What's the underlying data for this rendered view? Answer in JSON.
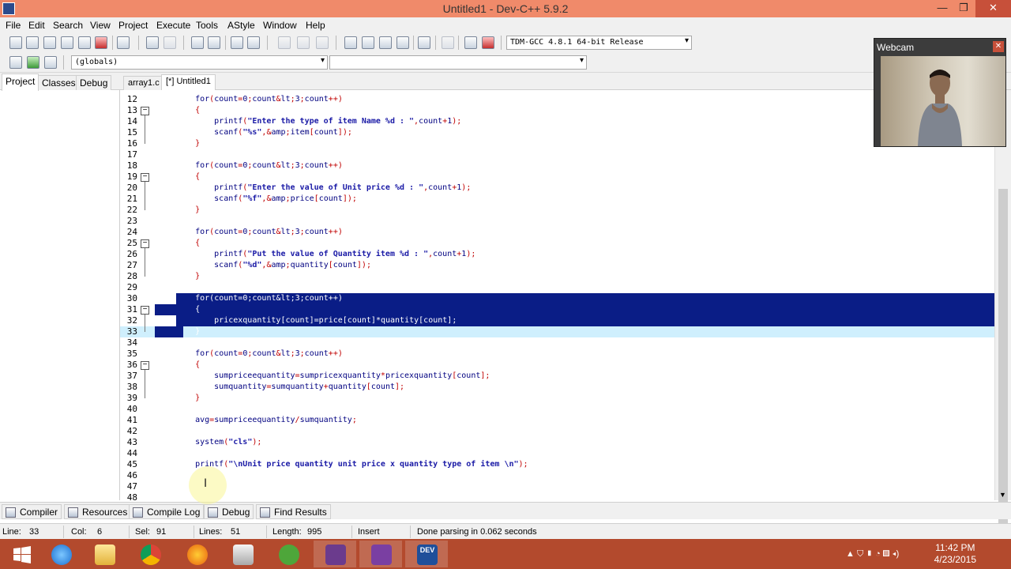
{
  "window": {
    "title": "Untitled1 - Dev-C++ 5.9.2",
    "minimize_glyph": "—",
    "maximize_glyph": "❐",
    "close_glyph": "✕"
  },
  "menu": [
    "File",
    "Edit",
    "Search",
    "View",
    "Project",
    "Execute",
    "Tools",
    "AStyle",
    "Window",
    "Help"
  ],
  "toolbar": {
    "compiler_select": "TDM-GCC 4.8.1 64-bit Release",
    "scope_select": "(globals)",
    "function_select": "",
    "dropdown_glyph": "▾"
  },
  "left_panel": {
    "tabs": [
      "Project",
      "Classes",
      "Debug"
    ],
    "active_tab": "Project"
  },
  "editor_tabs": [
    {
      "label": "array1.c",
      "active": false
    },
    {
      "label": "[*] Untitled1",
      "active": true
    }
  ],
  "editor": {
    "fold_glyph": "−",
    "lines": [
      {
        "num": "12",
        "text": "    for(count=0;count<3;count++)"
      },
      {
        "num": "13",
        "text": "    {"
      },
      {
        "num": "14",
        "text": "        printf(\"Enter the type of item Name %d : \",count+1);"
      },
      {
        "num": "15",
        "text": "        scanf(\"%s\",&item[count]);"
      },
      {
        "num": "16",
        "text": "    }"
      },
      {
        "num": "17",
        "text": ""
      },
      {
        "num": "18",
        "text": "    for(count=0;count<3;count++)"
      },
      {
        "num": "19",
        "text": "    {"
      },
      {
        "num": "20",
        "text": "        printf(\"Enter the value of Unit price %d : \",count+1);"
      },
      {
        "num": "21",
        "text": "        scanf(\"%f\",&price[count]);"
      },
      {
        "num": "22",
        "text": "    }"
      },
      {
        "num": "23",
        "text": ""
      },
      {
        "num": "24",
        "text": "    for(count=0;count<3;count++)"
      },
      {
        "num": "25",
        "text": "    {"
      },
      {
        "num": "26",
        "text": "        printf(\"Put the value of Quantity item %d : \",count+1);"
      },
      {
        "num": "27",
        "text": "        scanf(\"%d\",&quantity[count]);"
      },
      {
        "num": "28",
        "text": "    }"
      },
      {
        "num": "29",
        "text": ""
      },
      {
        "num": "30",
        "text": "    for(count=0;count<3;count++)"
      },
      {
        "num": "31",
        "text": "    {"
      },
      {
        "num": "32",
        "text": "        pricexquantity[count]=price[count]*quantity[count];"
      },
      {
        "num": "33",
        "text": "    }"
      },
      {
        "num": "34",
        "text": ""
      },
      {
        "num": "35",
        "text": "    for(count=0;count<3;count++)"
      },
      {
        "num": "36",
        "text": "    {"
      },
      {
        "num": "37",
        "text": "        sumpriceequantity=sumpricexquantity*pricexquantity[count];"
      },
      {
        "num": "38",
        "text": "        sumquantity=sumquantity+quantity[count];"
      },
      {
        "num": "39",
        "text": "    }"
      },
      {
        "num": "40",
        "text": ""
      },
      {
        "num": "41",
        "text": "    avg=sumpriceequantity/sumquantity;"
      },
      {
        "num": "42",
        "text": ""
      },
      {
        "num": "43",
        "text": "    system(\"cls\");"
      },
      {
        "num": "44",
        "text": ""
      },
      {
        "num": "45",
        "text": "    printf(\"\\nUnit price quantity unit price x quantity type of item \\n\");"
      },
      {
        "num": "46",
        "text": ""
      },
      {
        "num": "47",
        "text": ""
      },
      {
        "num": "48",
        "text": ""
      }
    ]
  },
  "webcam": {
    "title": "Webcam",
    "close_glyph": "✕"
  },
  "bottom_tabs": [
    "Compiler",
    "Resources",
    "Compile Log",
    "Debug",
    "Find Results"
  ],
  "status": {
    "line_label": "Line:",
    "line_value": "33",
    "col_label": "Col:",
    "col_value": "6",
    "sel_label": "Sel:",
    "sel_value": "91",
    "lines_label": "Lines:",
    "lines_value": "51",
    "length_label": "Length:",
    "length_value": "995",
    "mode": "Insert",
    "message": "Done parsing in 0.062 seconds"
  },
  "taskbar": {
    "time": "11:42 PM",
    "date": "4/23/2015",
    "apps": [
      "start",
      "internet-explorer",
      "file-explorer",
      "chrome",
      "firefox",
      "video-editor",
      "utorrent",
      "camtasia-recorder",
      "camtasia-studio",
      "dev-cpp"
    ],
    "dev_icon_text": "DEV",
    "tray_glyphs": "▲  ⛉  ▮  ◔  ▥  ◂)"
  },
  "colors": {
    "title_bar": "#f08a6a",
    "taskbar": "#b34a2d",
    "selection": "#0a1d86",
    "current_line": "#cfeffd"
  }
}
